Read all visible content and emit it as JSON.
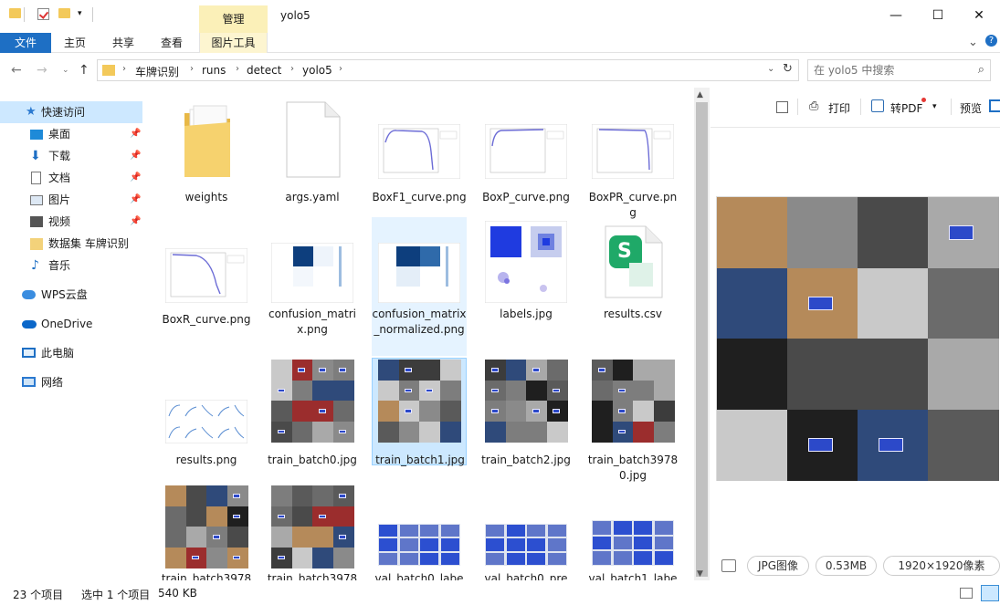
{
  "titlebar": {
    "manage_tab": "管理",
    "window_title": "yolo5",
    "minimize": "—",
    "maximize": "☐",
    "close": "✕"
  },
  "ribbon": {
    "file": "文件",
    "home": "主页",
    "share": "共享",
    "view": "查看",
    "picture_tools": "图片工具"
  },
  "address": {
    "crumbs": [
      "车牌识别",
      "runs",
      "detect",
      "yolo5"
    ],
    "search_placeholder": "在 yolo5 中搜索"
  },
  "sidebar": {
    "items": [
      {
        "label": "快速访问",
        "icon": "star-icon"
      },
      {
        "label": "桌面",
        "icon": "desktop-icon"
      },
      {
        "label": "下载",
        "icon": "download-icon"
      },
      {
        "label": "文档",
        "icon": "document-icon"
      },
      {
        "label": "图片",
        "icon": "picture-icon"
      },
      {
        "label": "视频",
        "icon": "video-icon"
      },
      {
        "label": "数据集 车牌识别",
        "icon": "folder-icon"
      },
      {
        "label": "音乐",
        "icon": "music-icon"
      },
      {
        "label": "WPS云盘",
        "icon": "cloud-icon"
      },
      {
        "label": "OneDrive",
        "icon": "onedrive-icon"
      },
      {
        "label": "此电脑",
        "icon": "computer-icon"
      },
      {
        "label": "网络",
        "icon": "network-icon"
      }
    ]
  },
  "files": [
    {
      "name": "weights",
      "kind": "folder"
    },
    {
      "name": "args.yaml",
      "kind": "doc"
    },
    {
      "name": "BoxF1_curve.png",
      "kind": "curve"
    },
    {
      "name": "BoxP_curve.png",
      "kind": "curve"
    },
    {
      "name": "BoxPR_curve.png",
      "kind": "curve"
    },
    {
      "name": "BoxR_curve.png",
      "kind": "curve"
    },
    {
      "name": "confusion_matrix.png",
      "kind": "matrix"
    },
    {
      "name": "confusion_matrix_normalized.png",
      "kind": "matrix"
    },
    {
      "name": "labels.jpg",
      "kind": "labels"
    },
    {
      "name": "results.csv",
      "kind": "csv"
    },
    {
      "name": "results.png",
      "kind": "results"
    },
    {
      "name": "train_batch0.jpg",
      "kind": "mosaic"
    },
    {
      "name": "train_batch1.jpg",
      "kind": "mosaic"
    },
    {
      "name": "train_batch2.jpg",
      "kind": "mosaic"
    },
    {
      "name": "train_batch39780.jpg",
      "kind": "mosaic"
    },
    {
      "name": "train_batch3978",
      "kind": "mosaic"
    },
    {
      "name": "train_batch3978",
      "kind": "mosaic"
    },
    {
      "name": "val_batch0_labe",
      "kind": "plates"
    },
    {
      "name": "val_batch0_pre",
      "kind": "plates"
    },
    {
      "name": "val_batch1_labe",
      "kind": "plates"
    }
  ],
  "preview": {
    "print": "打印",
    "to_pdf": "转PDF",
    "preview": "预览",
    "type": "JPG图像",
    "size": "0.53MB",
    "dimensions": "1920×1920像素"
  },
  "status": {
    "count": "23 个项目",
    "selected": "选中 1 个项目",
    "selected_size": "540 KB"
  },
  "colors": {
    "accent": "#1e6fc4",
    "selection": "#cce8ff",
    "folder": "#f3c95a",
    "manage_tab": "#fbf0b8"
  }
}
